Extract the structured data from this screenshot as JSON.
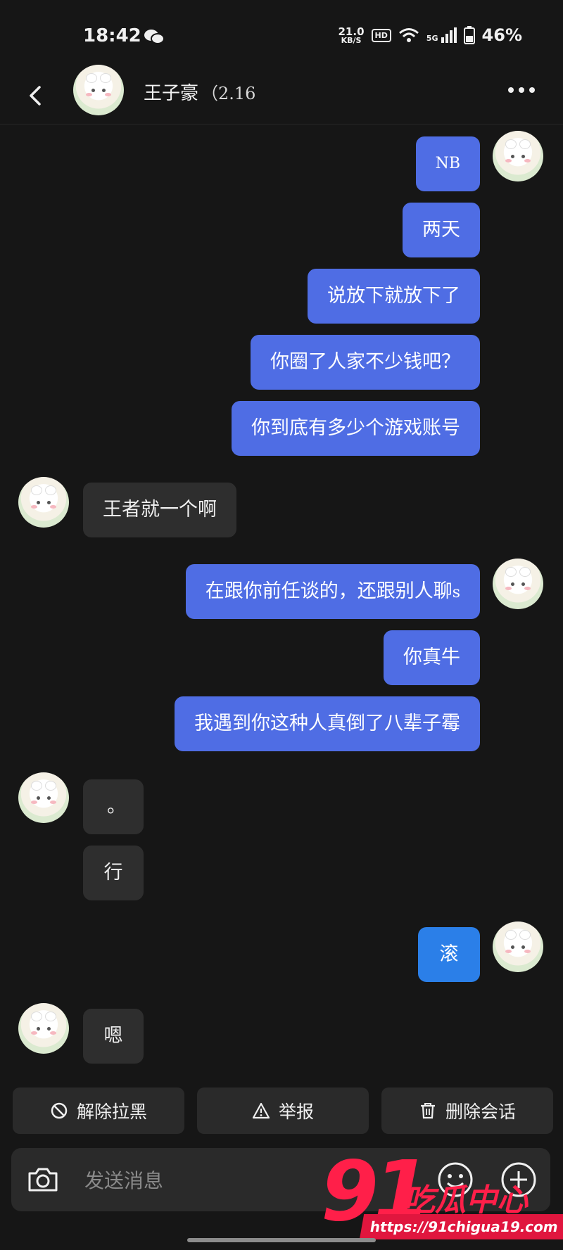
{
  "status_bar": {
    "time": "18:42",
    "net_speed": "21.0",
    "net_unit": "KB/S",
    "hd": "HD",
    "signal": "5G",
    "battery": "46%"
  },
  "header": {
    "contact_name": "王子豪",
    "contact_sub": "（2.16"
  },
  "messages": [
    {
      "side": "out",
      "text": "NB"
    },
    {
      "side": "out",
      "text": "两天"
    },
    {
      "side": "out",
      "text": "说放下就放下了"
    },
    {
      "side": "out",
      "text": "你圈了人家不少钱吧？"
    },
    {
      "side": "out",
      "text": "你到底有多少个游戏账号"
    },
    {
      "side": "in",
      "text": "王者就一个啊"
    },
    {
      "side": "out",
      "text": "在跟你前任谈的，还跟别人聊",
      "suffix": "s"
    },
    {
      "side": "out",
      "text": "你真牛"
    },
    {
      "side": "out",
      "text": "我遇到你这种人真倒了八辈子霉"
    },
    {
      "side": "in",
      "text": "。"
    },
    {
      "side": "in",
      "text": "行"
    },
    {
      "side": "out",
      "text": "滚"
    },
    {
      "side": "in",
      "text": "嗯"
    }
  ],
  "actions": {
    "unblock": "解除拉黑",
    "report": "举报",
    "delete": "删除会话"
  },
  "composer": {
    "placeholder": "发送消息"
  },
  "watermark": {
    "number": "91",
    "brand": "吃瓜中心",
    "url": "https://91chigua19.com"
  },
  "colors": {
    "outgoing_bubble": "#4f6de4",
    "incoming_bubble": "#2e2e2e",
    "background": "#161616",
    "watermark": "#ff1f49"
  }
}
